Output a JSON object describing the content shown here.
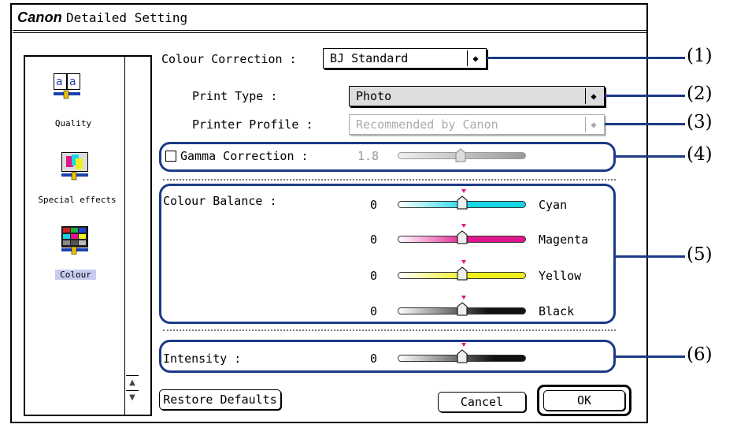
{
  "window": {
    "brand": "Canon",
    "title": "Detailed Setting"
  },
  "sidebar": {
    "items": [
      {
        "label": "Quality",
        "icon": "quality-icon"
      },
      {
        "label": "Special effects",
        "icon": "special-effects-icon"
      },
      {
        "label": "Colour",
        "icon": "colour-icon",
        "selected": true
      }
    ]
  },
  "colour_correction": {
    "label": "Colour Correction :",
    "value": "BJ Standard"
  },
  "print_type": {
    "label": "Print Type :",
    "value": "Photo"
  },
  "printer_profile": {
    "label": "Printer Profile :",
    "value": "Recommended by Canon"
  },
  "gamma": {
    "label": "Gamma Correction :",
    "value": "1.8",
    "checked": false
  },
  "colour_balance": {
    "label": "Colour Balance :",
    "channels": [
      {
        "name": "Cyan",
        "value": "0",
        "color": "#19d6e6"
      },
      {
        "name": "Magenta",
        "value": "0",
        "color": "#e0158c"
      },
      {
        "name": "Yellow",
        "value": "0",
        "color": "#f0f01e"
      },
      {
        "name": "Black",
        "value": "0",
        "color": "#111111"
      }
    ]
  },
  "intensity": {
    "label": "Intensity :",
    "value": "0"
  },
  "buttons": {
    "restore": "Restore Defaults",
    "cancel": "Cancel",
    "ok": "OK"
  },
  "callouts": [
    "(1)",
    "(2)",
    "(3)",
    "(4)",
    "(5)",
    "(6)"
  ],
  "colors": {
    "annotation": "#1c3a86",
    "pin": "#e0158c"
  }
}
